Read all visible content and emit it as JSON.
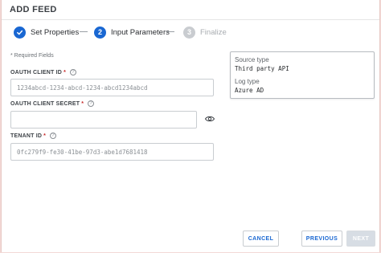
{
  "dialog": {
    "title": "ADD FEED"
  },
  "stepper": {
    "steps": [
      {
        "number": "1",
        "label": "Set Properties",
        "state": "done"
      },
      {
        "number": "2",
        "label": "Input Parameters",
        "state": "active"
      },
      {
        "number": "3",
        "label": "Finalize",
        "state": "pending"
      }
    ]
  },
  "form": {
    "required_note": "* Required Fields",
    "client_id": {
      "label": "OAUTH CLIENT ID",
      "required_mark": "*",
      "value": "1234abcd-1234-abcd-1234-abcd1234abcd"
    },
    "client_secret": {
      "label": "OAUTH CLIENT SECRET",
      "required_mark": "*",
      "value": ""
    },
    "tenant_id": {
      "label": "TENANT ID",
      "required_mark": "*",
      "value": "0fc279f9-fe30-41be-97d3-abe1d7681418"
    }
  },
  "info": {
    "source_type_label": "Source type",
    "source_type_value": "Third party API",
    "log_type_label": "Log type",
    "log_type_value": "Azure AD"
  },
  "buttons": {
    "cancel": "CANCEL",
    "previous": "PREVIOUS",
    "next": "NEXT"
  },
  "colors": {
    "accent": "#1967d2",
    "pending": "#c9ccd0",
    "required": "#c62828"
  },
  "icons": {
    "step_done": "checkmark-icon",
    "help": "help-circle-icon",
    "visibility": "eye-icon"
  }
}
